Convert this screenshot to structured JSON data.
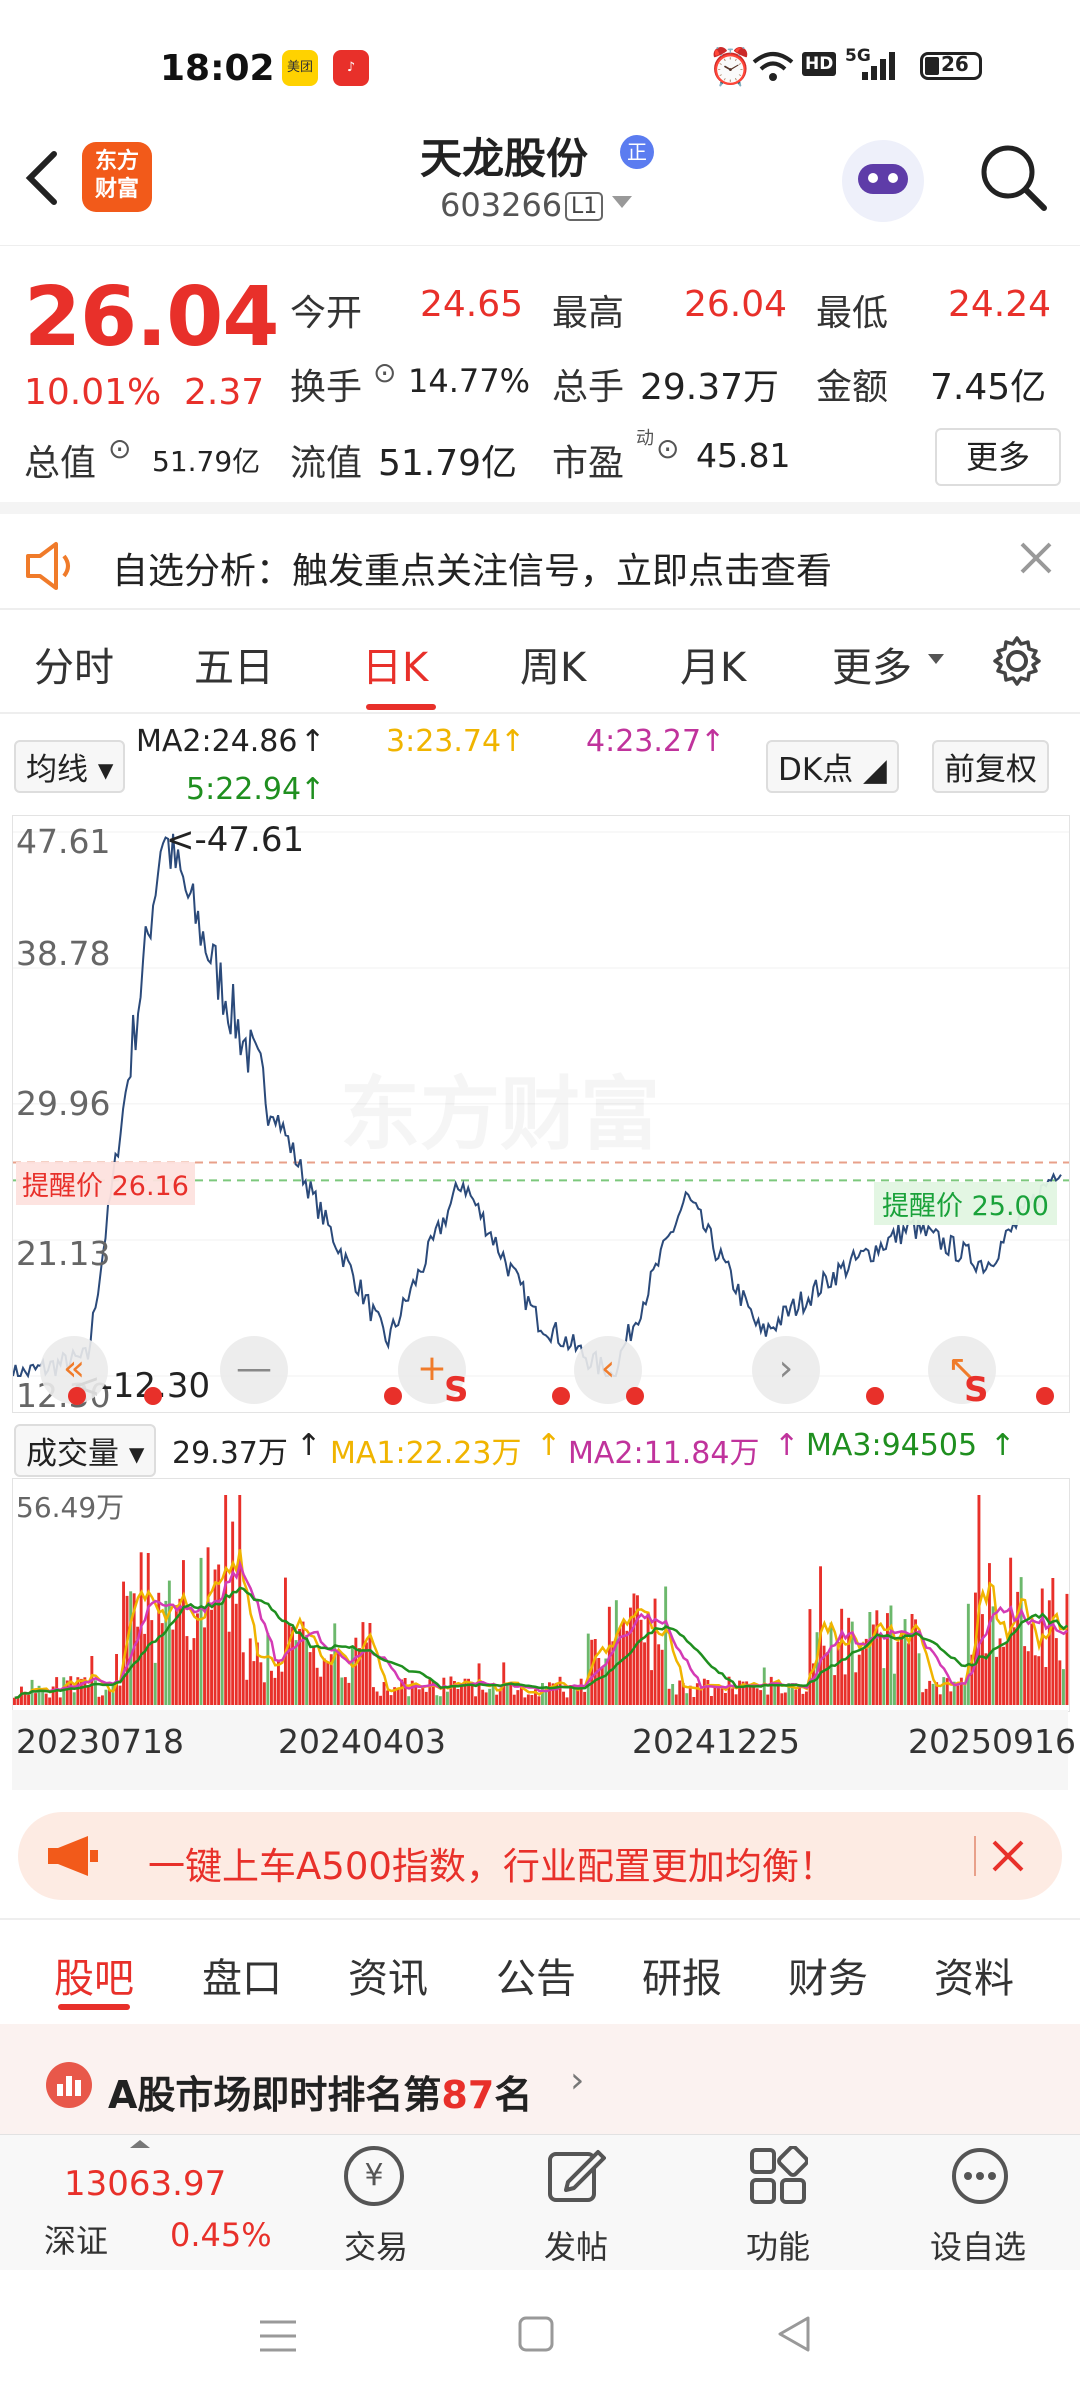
{
  "status_bar": {
    "time": "18:02",
    "battery": "26",
    "badge1": "美团",
    "signal": "5G",
    "hd": "HD"
  },
  "header": {
    "stock_name": "天龙股份",
    "tag": "正",
    "code": "603266",
    "level": "L1",
    "logo_line1": "东方",
    "logo_line2": "财富"
  },
  "quote": {
    "price": "26.04",
    "change_pct": "10.01%",
    "change": "2.37",
    "open_label": "今开",
    "open": "24.65",
    "high_label": "最高",
    "high": "26.04",
    "low_label": "最低",
    "low": "24.24",
    "turnover_label": "换手",
    "turnover": "14.77%",
    "volume_label": "总手",
    "volume": "29.37万",
    "amount_label": "金额",
    "amount": "7.45亿",
    "mktcap_label": "总值",
    "mktcap": "51.79亿",
    "float_label": "流值",
    "float": "51.79亿",
    "pe_label": "市盈",
    "pe_sup": "动",
    "pe": "45.81",
    "more": "更多"
  },
  "alert": {
    "text": "自选分析：触发重点关注信号，立即点击查看"
  },
  "chart_tabs": [
    "分时",
    "五日",
    "日K",
    "周K",
    "月K",
    "更多"
  ],
  "ma_bar": {
    "selector": "均线",
    "ma2": "MA2:24.86",
    "ma3": "3:23.74",
    "ma4": "4:23.27",
    "ma5": "5:22.94",
    "dk": "DK点",
    "adjust": "前复权"
  },
  "price_chart": {
    "ticks": [
      "47.61",
      "38.78",
      "29.96",
      "21.13",
      "12.30"
    ],
    "max_label": "<-47.61",
    "min_label": "<-12.30",
    "alert_red": "提醒价 26.16",
    "alert_green": "提醒价 25.00",
    "watermark": "东方财富"
  },
  "volume_bar": {
    "selector": "成交量",
    "vol": "29.37万",
    "ma1": "MA1:22.23万",
    "ma2": "MA2:11.84万",
    "ma3": "MA3:94505",
    "max": "56.49万"
  },
  "dates": [
    "20230718",
    "20240403",
    "20241225",
    "20250916"
  ],
  "colors": {
    "up": "#e8302a",
    "down": "#1aa23a",
    "line": "#2b4a7a",
    "ma1": "#f0b400",
    "ma2": "#d43bb5",
    "ma3": "#1f8f1f"
  },
  "banner": {
    "text": "一键上车A500指数，行业配置更加均衡！"
  },
  "lower_tabs": [
    "股吧",
    "盘口",
    "资讯",
    "公告",
    "研报",
    "财务",
    "资料"
  ],
  "rank": {
    "prefix": "A股市场即时排名第",
    "num": "87",
    "suffix": "名"
  },
  "bottom_nav": {
    "index_value": "13063.97",
    "index_name": "深证",
    "index_pct": "0.45%",
    "items": [
      "交易",
      "发帖",
      "功能",
      "设自选"
    ]
  },
  "chart_data": {
    "type": "line",
    "title": "",
    "x": [
      "20230718",
      "20240403",
      "20241225",
      "20250916"
    ],
    "series": [
      {
        "values": [
          12.3,
          13.5,
          47.61,
          35.0,
          24.0,
          14.5,
          25.0,
          16.0,
          12.3,
          24.0,
          15.0,
          19.0,
          22.0,
          19.5,
          26.04
        ]
      }
    ],
    "ylim": [
      12.3,
      47.61
    ]
  }
}
